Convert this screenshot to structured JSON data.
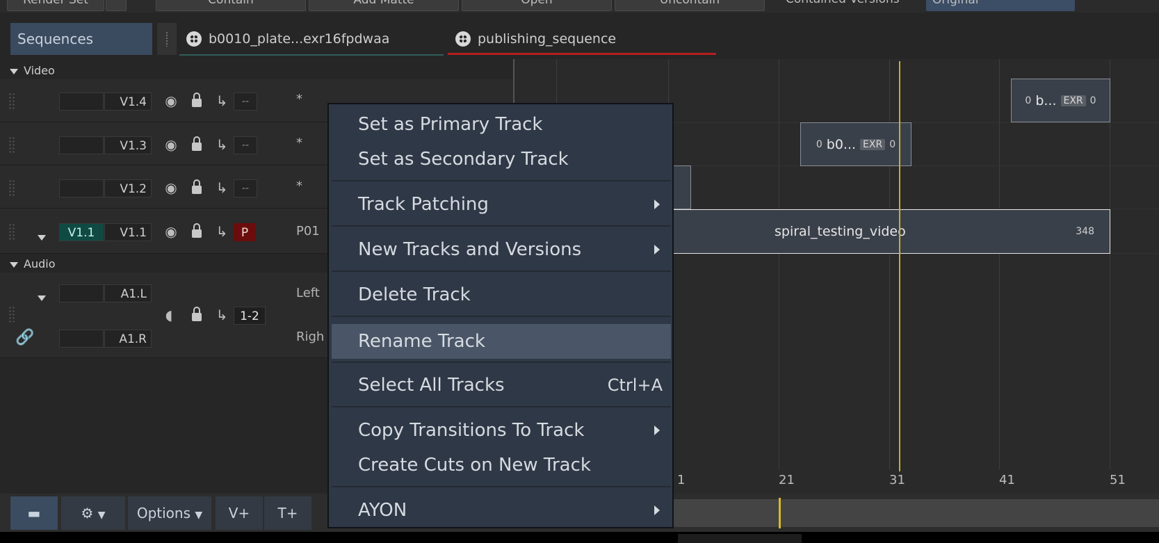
{
  "toolbar": {
    "render_set": "Render Set",
    "contain": "Contain",
    "add_matte": "Add Matte",
    "open": "Open",
    "uncontain": "Uncontain",
    "contained_versions_label": "Contained Versions",
    "contained_versions_value": "Original"
  },
  "tabs": {
    "sequences": "Sequences",
    "tab1": "b0010_plate...exr16fpdwaa",
    "tab2": "publishing_sequence"
  },
  "sections": {
    "video": "Video",
    "audio": "Audio"
  },
  "video_tracks": [
    {
      "name": "V1.4",
      "patch": "--",
      "label": "*"
    },
    {
      "name": "V1.3",
      "patch": "--",
      "label": "*"
    },
    {
      "name": "V1.2",
      "patch": "--",
      "label": "*"
    },
    {
      "name": "V1.1",
      "source": "V1.1",
      "patch": "P",
      "label": "P01"
    }
  ],
  "audio_tracks": {
    "left": "A1.L",
    "right": "A1.R",
    "patch": "1-2",
    "left_label": "Left",
    "right_label": "Righ"
  },
  "clips": {
    "top_right": {
      "in": "0",
      "name": "b...",
      "badge": "EXR",
      "out": "0"
    },
    "middle": {
      "in": "0",
      "name": "b0...",
      "badge": "EXR",
      "out": "0"
    },
    "main": {
      "name": "spiral_testing_video",
      "out": "348"
    }
  },
  "ruler": [
    "1",
    "21",
    "31",
    "41",
    "51"
  ],
  "bottom": {
    "options": "Options",
    "vplus": "V+",
    "tplus": "T+"
  },
  "context_menu": {
    "items": [
      {
        "label": "Set as Primary Track"
      },
      {
        "label": "Set as Secondary Track"
      },
      {
        "label": "Track Patching",
        "submenu": true
      },
      {
        "label": "New Tracks and Versions",
        "submenu": true
      },
      {
        "label": "Delete Track"
      },
      {
        "label": "Rename Track",
        "highlighted": true
      },
      {
        "label": "Select All Tracks",
        "shortcut": "Ctrl+A"
      },
      {
        "label": "Copy Transitions To Track",
        "submenu": true
      },
      {
        "label": "Create Cuts on New Track"
      },
      {
        "label": "AYON",
        "submenu": true
      }
    ]
  }
}
